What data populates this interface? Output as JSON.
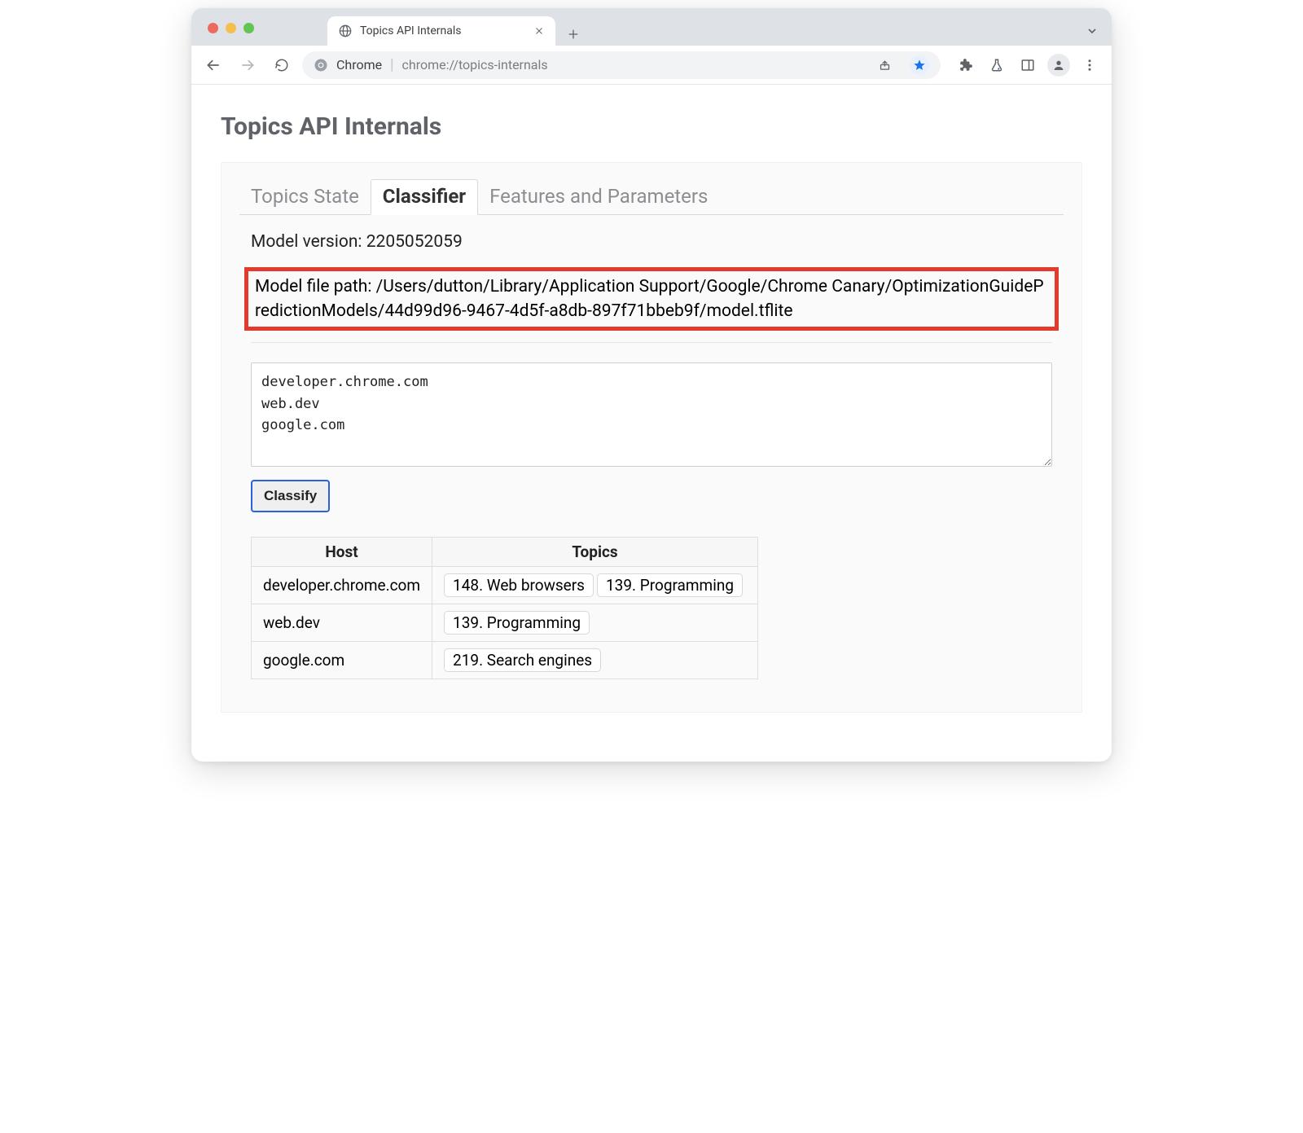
{
  "window": {
    "tab_title": "Topics API Internals",
    "omnibox_label": "Chrome",
    "omnibox_url": "chrome://topics-internals"
  },
  "page": {
    "title": "Topics API Internals",
    "tabs": [
      {
        "label": "Topics State",
        "active": false
      },
      {
        "label": "Classifier",
        "active": true
      },
      {
        "label": "Features and Parameters",
        "active": false
      }
    ],
    "model_version_label": "Model version: ",
    "model_version": "2205052059",
    "model_path_label": "Model file path: ",
    "model_path": "/Users/dutton/Library/Application Support/Google/Chrome Canary/OptimizationGuidePredictionModels/44d99d96-9467-4d5f-a8db-897f71bbeb9f/model.tflite",
    "hosts_input": "developer.chrome.com\nweb.dev\ngoogle.com",
    "classify_button": "Classify",
    "table": {
      "headers": [
        "Host",
        "Topics"
      ],
      "rows": [
        {
          "host": "developer.chrome.com",
          "topics": [
            "148. Web browsers",
            "139. Programming"
          ]
        },
        {
          "host": "web.dev",
          "topics": [
            "139. Programming"
          ]
        },
        {
          "host": "google.com",
          "topics": [
            "219. Search engines"
          ]
        }
      ]
    }
  },
  "icons": {
    "globe": "globe-icon",
    "close": "close-icon",
    "plus": "plus-icon",
    "chevron": "chevron-down-icon",
    "back": "back-icon",
    "forward": "forward-icon",
    "reload": "reload-icon",
    "chrome": "chrome-icon",
    "share": "share-icon",
    "star": "star-icon",
    "puzzle": "puzzle-icon",
    "labs": "labs-icon",
    "panel": "panel-icon",
    "avatar": "avatar-icon",
    "menu": "menu-icon"
  }
}
